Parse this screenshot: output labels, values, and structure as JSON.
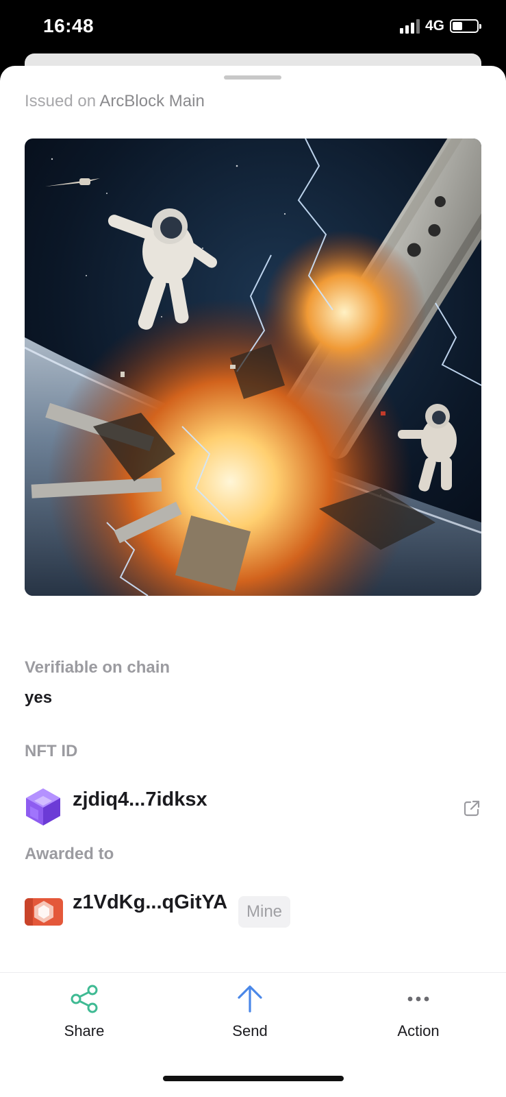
{
  "status_bar": {
    "time": "16:48",
    "network": "4G",
    "signal_icon": "cellular-signal-icon",
    "battery_icon": "battery-icon"
  },
  "header": {
    "issued_prefix": "Issued  on ",
    "chain_name": "ArcBlock Main"
  },
  "hero_image": {
    "description_icon": "nft-artwork-image"
  },
  "details": {
    "verifiable_label": "Verifiable on chain",
    "verifiable_value": "yes",
    "nft_id_label": "NFT ID",
    "nft_id_value": "zjdiq4...7idksx",
    "awarded_label": "Awarded to",
    "awarded_value": "z1VdKg...qGitYA",
    "mine_badge": "Mine"
  },
  "bottom_bar": {
    "share_label": "Share",
    "send_label": "Send",
    "action_label": "Action"
  },
  "colors": {
    "share_icon": "#3fba93",
    "send_icon": "#4a87e8",
    "action_icon": "#6b6b70",
    "nft_avatar": "#8e5cf0",
    "awarded_avatar": "#e4583a"
  }
}
